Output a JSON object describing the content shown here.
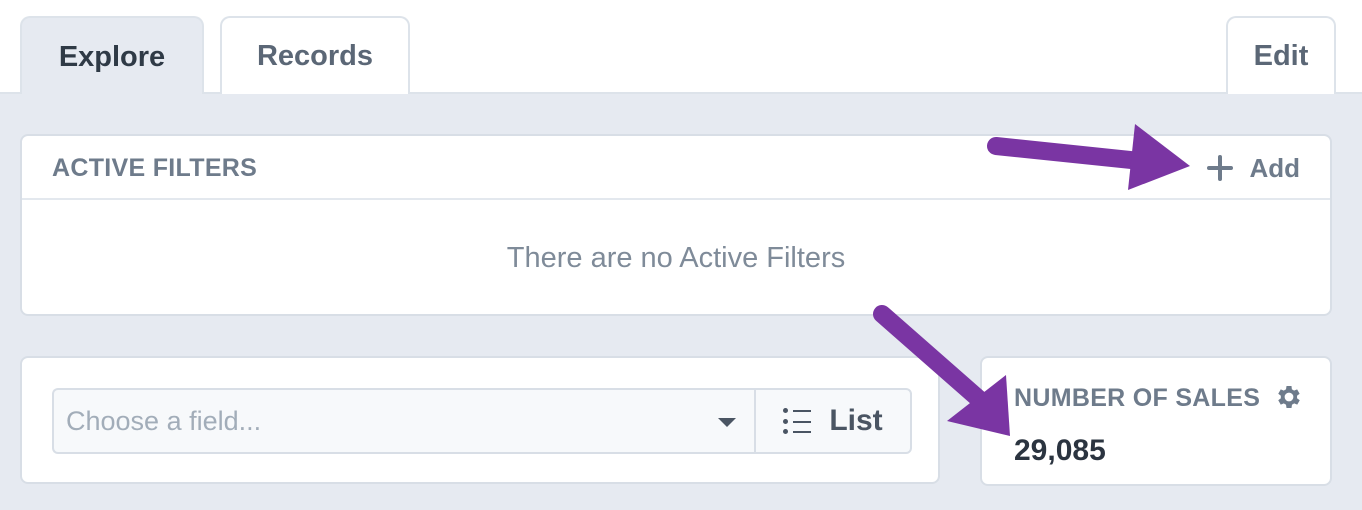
{
  "tabs": {
    "explore": "Explore",
    "records": "Records",
    "edit": "Edit"
  },
  "filters": {
    "title": "ACTIVE FILTERS",
    "add_label": "Add",
    "empty_message": "There are no Active Filters"
  },
  "field_picker": {
    "placeholder": "Choose a field...",
    "list_label": "List"
  },
  "metric": {
    "title": "NUMBER OF SALES",
    "value": "29,085"
  },
  "colors": {
    "accent_arrow": "#7a35a3",
    "panel_background": "#e6eaf1"
  },
  "icons": [
    "plus-icon",
    "caret-down-icon",
    "list-icon",
    "gear-icon",
    "arrow-annotation"
  ]
}
